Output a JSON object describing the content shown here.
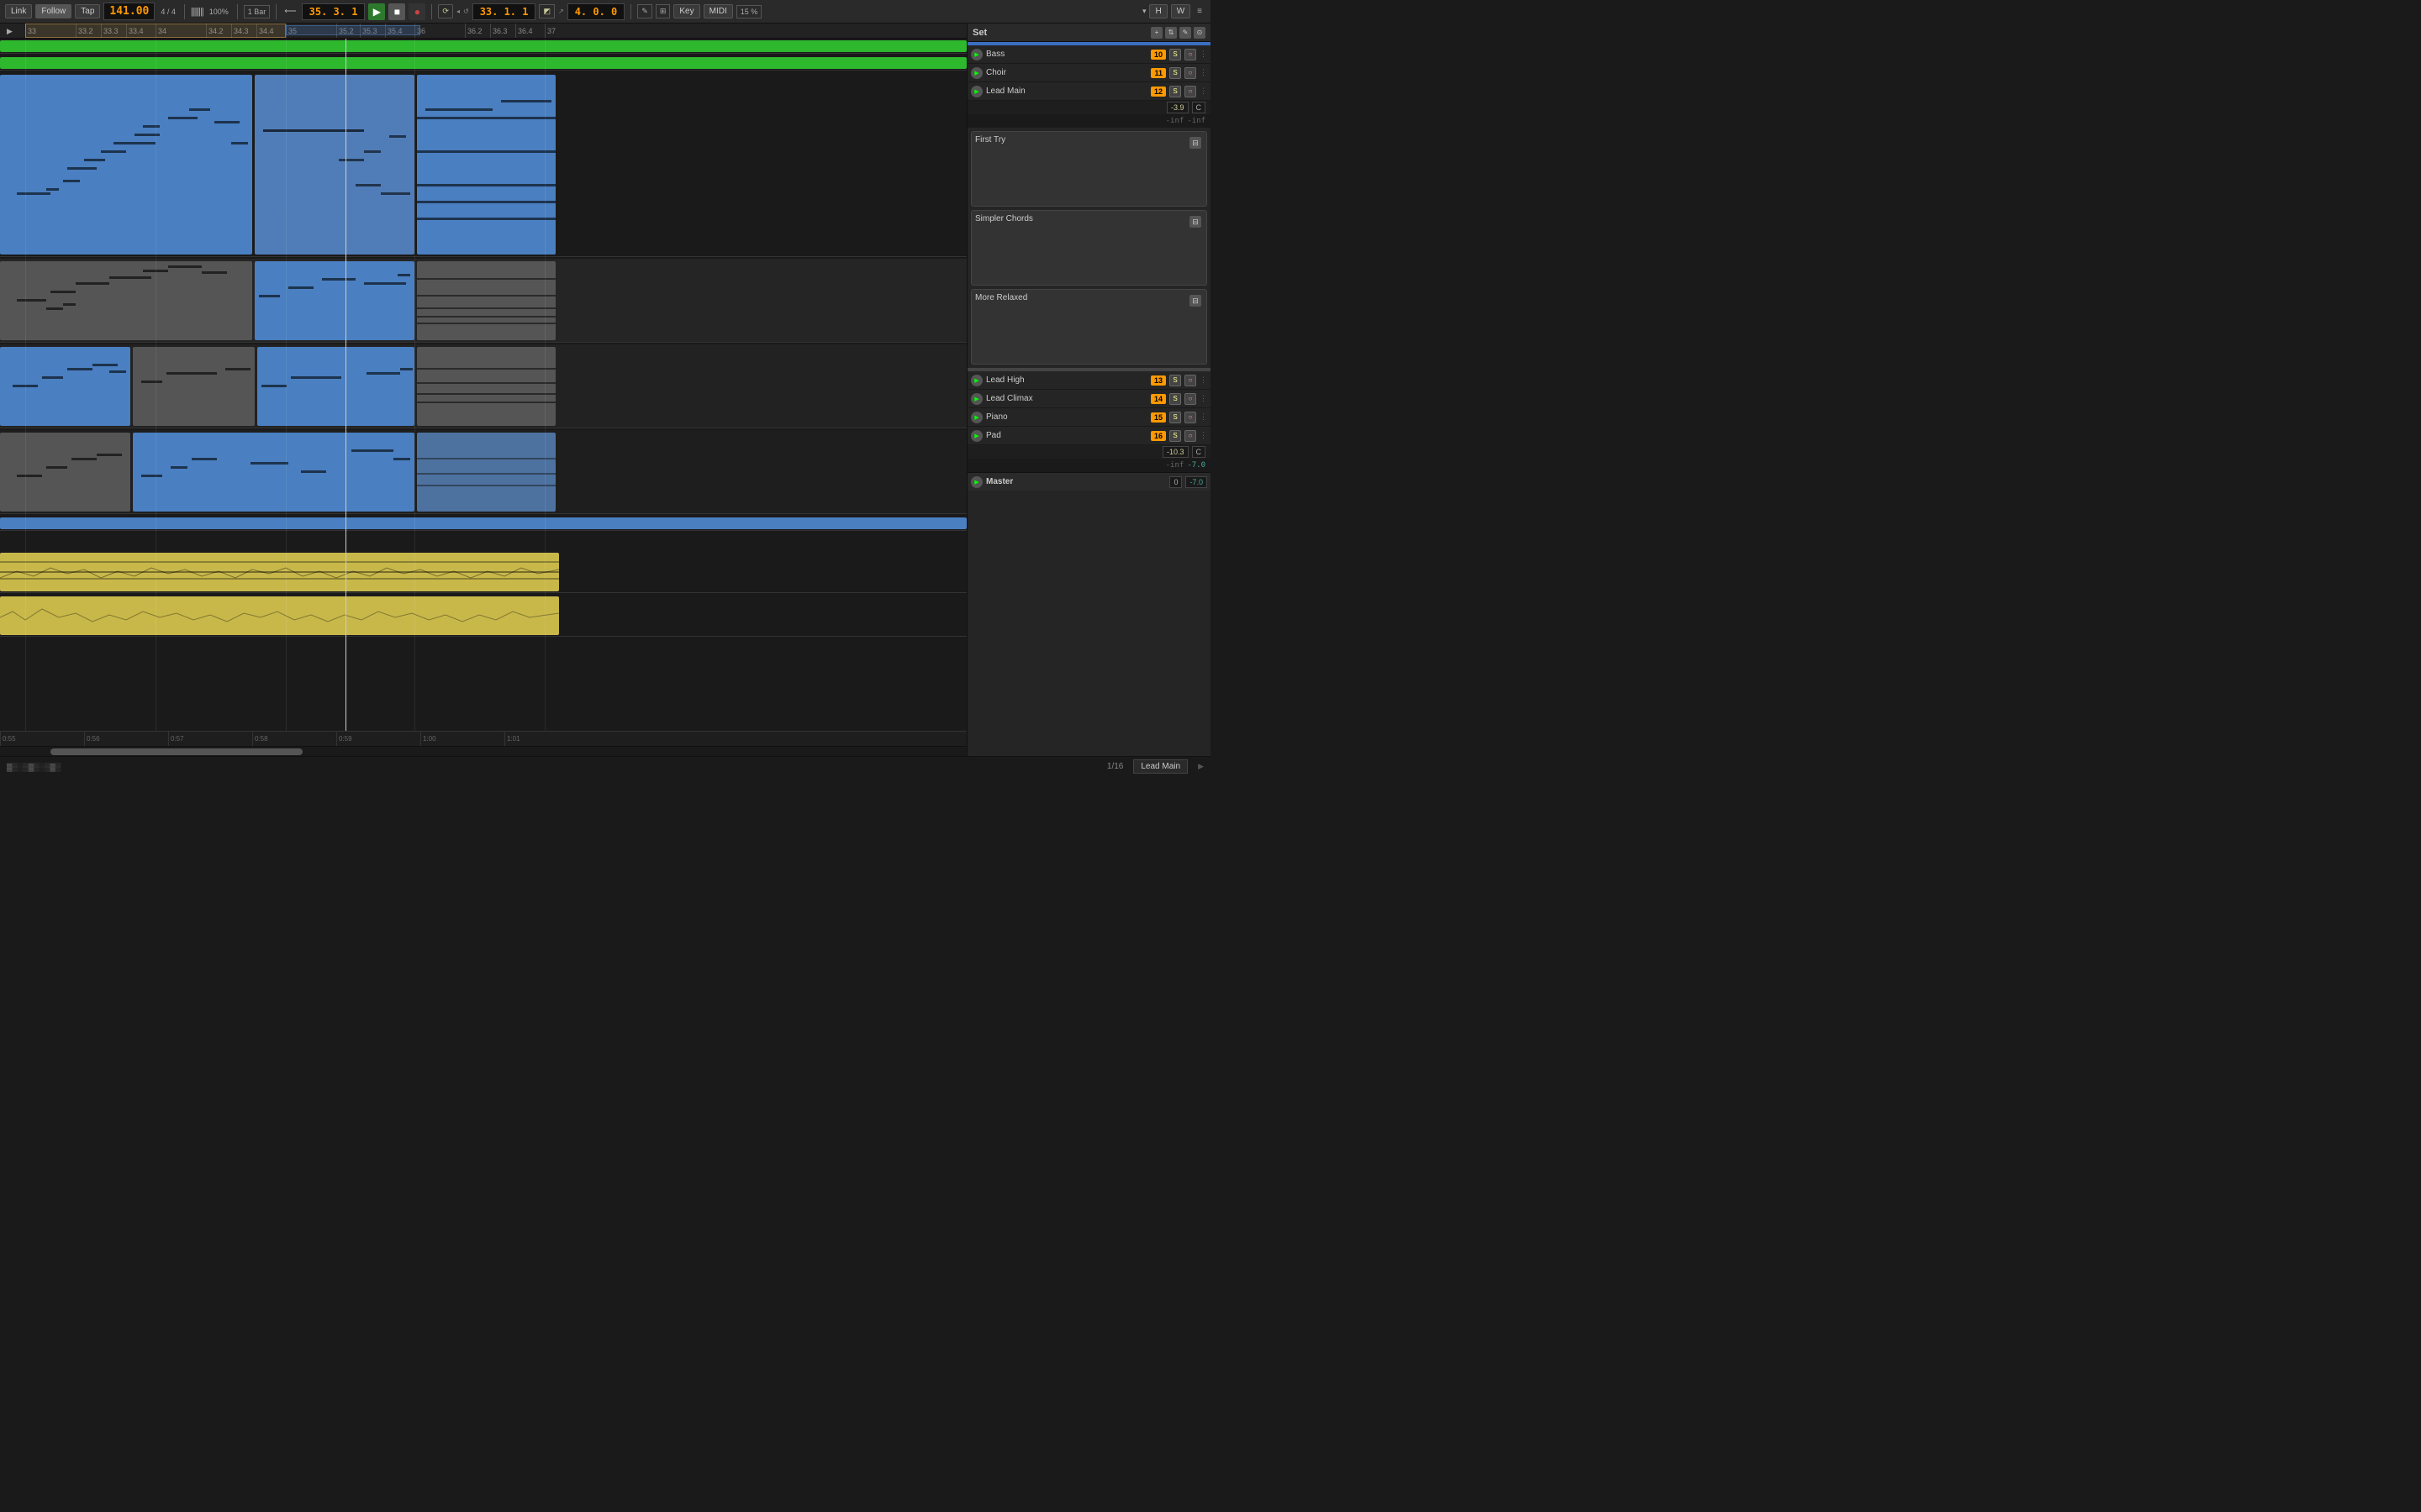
{
  "toolbar": {
    "link": "Link",
    "follow": "Follow",
    "tap": "Tap",
    "bpm": "141.00",
    "time_sig": "4 / 4",
    "zoom": "100%",
    "quantize": "1 Bar",
    "pos": "35.  3.  1",
    "loop_start": "33.  1.  1",
    "loop_end": "4.  0.  0",
    "midi_label": "MIDI",
    "key_label": "Key",
    "percent": "15 %",
    "h_label": "H",
    "w_label": "W"
  },
  "ruler": {
    "marks": [
      "33",
      "33.2",
      "33.3",
      "33.4",
      "34",
      "34.2",
      "34.3",
      "34.4",
      "35",
      "35.2",
      "35.3",
      "35.4",
      "36",
      "36.2",
      "36.3",
      "36.4",
      "37"
    ]
  },
  "tracks": {
    "set_label": "Set",
    "items": [
      {
        "name": "Bass",
        "num": "10",
        "color": "orange"
      },
      {
        "name": "Choir",
        "num": "11",
        "color": "orange"
      },
      {
        "name": "Lead Main",
        "num": "12",
        "color": "orange"
      },
      {
        "name": "Lead High",
        "num": "13",
        "color": "orange"
      },
      {
        "name": "Lead Climax",
        "num": "14",
        "color": "orange"
      },
      {
        "name": "Piano",
        "num": "15",
        "color": "orange"
      },
      {
        "name": "Pad",
        "num": "16",
        "color": "orange"
      }
    ]
  },
  "clips": [
    {
      "label": "First Try"
    },
    {
      "label": "Simpler Chords"
    },
    {
      "label": "More Relaxed"
    }
  ],
  "lead_main": {
    "vol_val": "-3.9",
    "pan_val": "C",
    "meter_l": "-inf",
    "meter_r": "-inf"
  },
  "pad": {
    "vol_val": "-10.3",
    "pan_val": "C",
    "meter_l": "-inf",
    "meter_r": "-7.0"
  },
  "master": {
    "label": "Master",
    "vol": "0",
    "pan": "-7.0"
  },
  "bottom": {
    "time_marks": [
      "0:55",
      "0:56",
      "0:57",
      "0:58",
      "0:59",
      "1:00",
      "1:01"
    ],
    "quantize": "1/16",
    "track_name": "Lead Main"
  }
}
